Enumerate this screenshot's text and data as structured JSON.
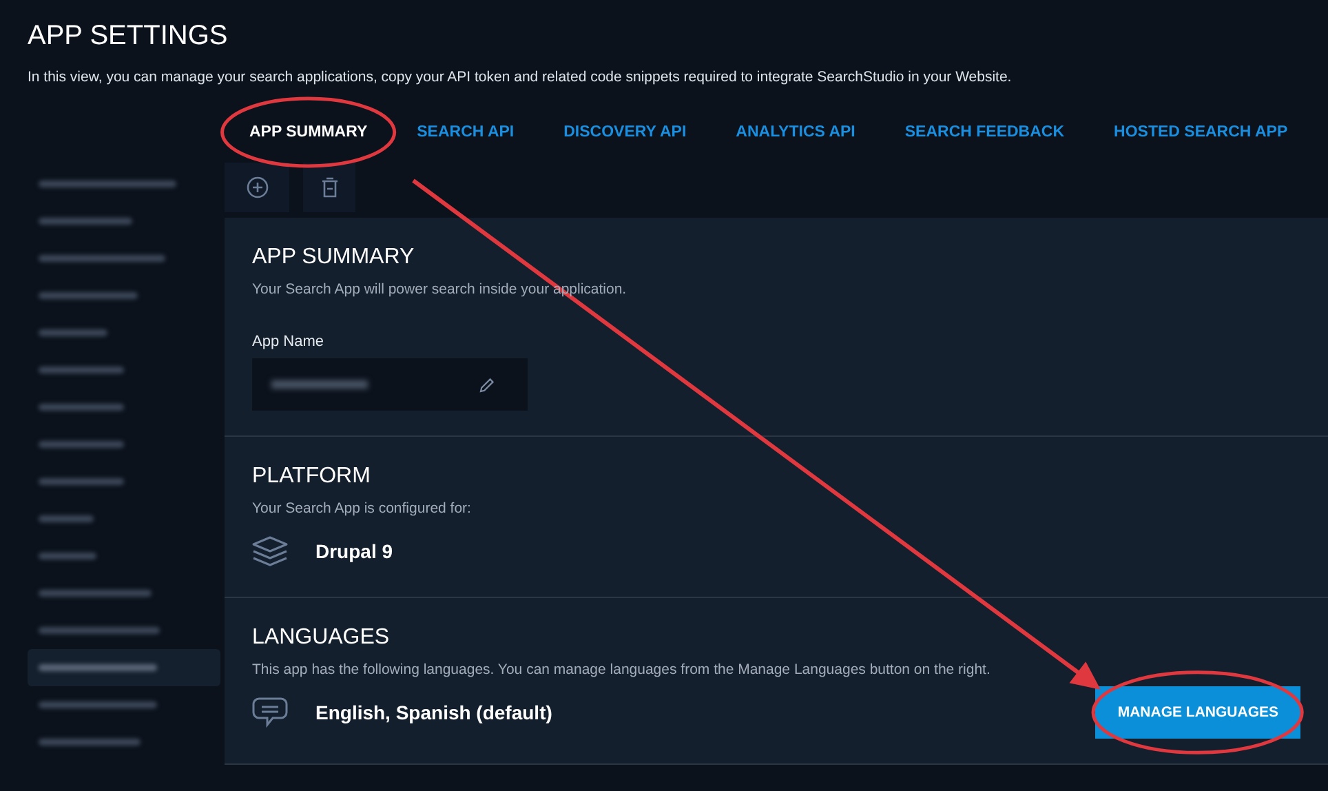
{
  "header": {
    "title": "APP SETTINGS",
    "description": "In this view, you can manage your search applications, copy your API token and related code snippets required to integrate SearchStudio in your Website."
  },
  "tabs": [
    {
      "label": "APP SUMMARY",
      "selected": true,
      "circled": true
    },
    {
      "label": "SEARCH API",
      "selected": false,
      "circled": false
    },
    {
      "label": "DISCOVERY API",
      "selected": false,
      "circled": false
    },
    {
      "label": "ANALYTICS API",
      "selected": false,
      "circled": false
    },
    {
      "label": "SEARCH FEEDBACK",
      "selected": false,
      "circled": false
    },
    {
      "label": "HOSTED SEARCH APP",
      "selected": false,
      "circled": false
    }
  ],
  "toolbar": [
    {
      "kind": "add"
    },
    {
      "kind": "delete"
    }
  ],
  "sidebar": {
    "items": [
      {
        "selected": false
      },
      {
        "selected": false
      },
      {
        "selected": false
      },
      {
        "selected": false
      },
      {
        "selected": false
      },
      {
        "selected": false
      },
      {
        "selected": false
      },
      {
        "selected": false
      },
      {
        "selected": false
      },
      {
        "selected": false
      },
      {
        "selected": false
      },
      {
        "selected": false
      },
      {
        "selected": false
      },
      {
        "selected": true
      },
      {
        "selected": false
      },
      {
        "selected": false
      }
    ]
  },
  "sections": [
    {
      "kind": "app_name",
      "title": "APP SUMMARY",
      "description": "Your Search App will power search inside your application.",
      "field_label": "App Name"
    },
    {
      "kind": "platform",
      "title": "PLATFORM",
      "description": "Your Search App is configured for:",
      "value": "Drupal 9"
    },
    {
      "kind": "languages",
      "title": "LANGUAGES",
      "description": "This app has the following languages. You can manage languages from the Manage Languages button on the right.",
      "value": "English, Spanish (default)",
      "button": {
        "label": "MANAGE LANGUAGES",
        "circled": true
      }
    }
  ],
  "annotation": {
    "arrow": true
  }
}
